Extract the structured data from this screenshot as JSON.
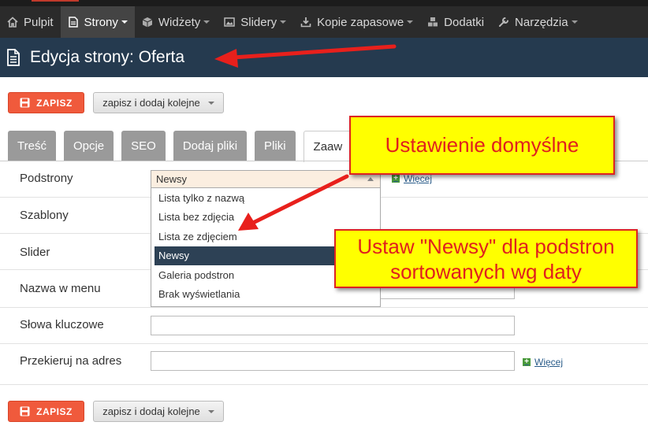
{
  "nav": {
    "items": [
      {
        "label": "Pulpit",
        "icon": "home-icon",
        "caret": false,
        "active": false
      },
      {
        "label": "Strony",
        "icon": "document-icon",
        "caret": true,
        "active": true
      },
      {
        "label": "Widżety",
        "icon": "cube-icon",
        "caret": true,
        "active": false
      },
      {
        "label": "Slidery",
        "icon": "image-icon",
        "caret": true,
        "active": false
      },
      {
        "label": "Kopie zapasowe",
        "icon": "download-icon",
        "caret": true,
        "active": false
      },
      {
        "label": "Dodatki",
        "icon": "cubes-icon",
        "caret": false,
        "active": false
      },
      {
        "label": "Narzędzia",
        "icon": "wrench-icon",
        "caret": true,
        "active": false
      }
    ]
  },
  "header": {
    "title": "Edycja strony: Oferta"
  },
  "toolbar": {
    "save_label": "ZAPISZ",
    "more_label": "zapisz i dodaj kolejne"
  },
  "tabs": [
    {
      "label": "Treść",
      "active": false
    },
    {
      "label": "Opcje",
      "active": false
    },
    {
      "label": "SEO",
      "active": false
    },
    {
      "label": "Dodaj pliki",
      "active": false
    },
    {
      "label": "Pliki",
      "active": false
    },
    {
      "label": "Zaaw",
      "active": true
    }
  ],
  "form": {
    "subpages_label": "Podstrony",
    "template_label": "Szablony",
    "slider_label": "Slider",
    "menu_name_label": "Nazwa w menu",
    "keywords_label": "Słowa kluczowe",
    "redirect_label": "Przekieruj na adres",
    "more_link": "Więcej",
    "subpages_selected": "Newsy",
    "subpages_options": [
      "Lista tylko z nazwą",
      "Lista bez zdjęcia",
      "Lista ze zdjęciem",
      "Newsy",
      "Galeria podstron",
      "Brak wyświetlania"
    ],
    "subpages_selected_index": 3
  },
  "callouts": {
    "default_setting": "Ustawienie domyślne",
    "newsy_line1": "Ustaw \"Newsy\" dla podstron",
    "newsy_line2": "sortowanych wg daty"
  },
  "colors": {
    "accent_save": "#f05a3c",
    "header_bg": "#253a4f",
    "callout_bg": "#ffff00",
    "callout_text": "#e0201e",
    "arrow": "#e8201c"
  }
}
